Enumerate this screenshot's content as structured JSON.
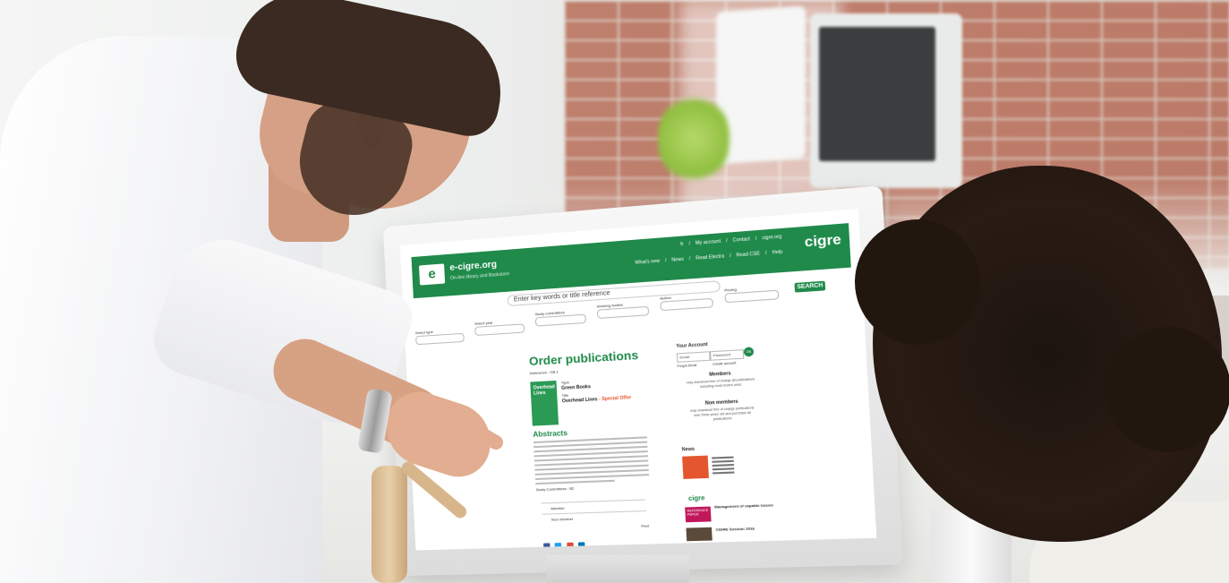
{
  "site": {
    "name": "e-cigre.org",
    "tagline": "On-line library and Bookstore",
    "logo_mark": "e",
    "brand": "cigre",
    "top_links": [
      "fr",
      "/",
      "My account",
      "/",
      "Contact",
      "/",
      "cigre.org"
    ],
    "nav_links": [
      "What's new",
      "/",
      "News",
      "/",
      "Read Electra",
      "/",
      "Read CSE",
      "/",
      "Help"
    ],
    "search_placeholder": "Enter key words or title reference",
    "search_button": "SEARCH",
    "filters": [
      "Select type",
      "Select year",
      "Study committees",
      "Working bodies",
      "Author",
      "Pricing"
    ]
  },
  "main": {
    "title": "Order publications",
    "reference_label": "Reference : GB 1",
    "book_cover": "Overhead Lines",
    "type_label": "Type",
    "type_value": "Green Books",
    "title_label": "Title",
    "title_value": "Overhead Lines",
    "special_offer": " - Special Offer",
    "abstract_title": "Abstracts",
    "study_committee": "Study Committees : B2",
    "row1": "Member",
    "row2": "Non member",
    "print_label": "Print"
  },
  "sidebar": {
    "account_title": "Your Account",
    "email_placeholder": "Email",
    "password_placeholder": "Password",
    "ok_label": "Ok",
    "forgot": "Forgot Email",
    "create": "Create account",
    "members_title": "Members",
    "members_text": "may download free of charge all publications including most recent ones",
    "nonmembers_title": "Non members",
    "nonmembers_text": "may download free of charge publications over three years old and purchase all publications",
    "news_title": "News",
    "cigre_logo": "cigre",
    "reference_paper": "REFERENCE PAPER",
    "ref_paper_title": "Management of capable issues",
    "session_title": "CIGRE Session 2016"
  },
  "colors": {
    "brand_green": "#1f8a4a",
    "accent_orange": "#e4572e",
    "magenta": "#c2185b"
  }
}
